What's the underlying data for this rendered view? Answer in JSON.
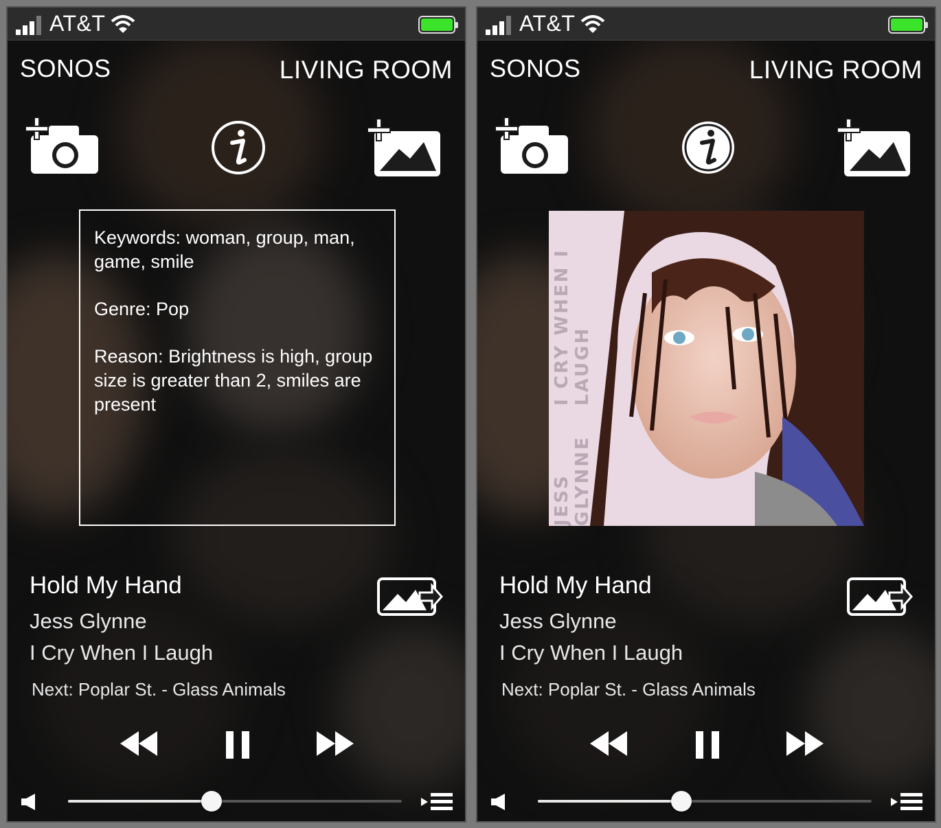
{
  "status_bar": {
    "carrier": "AT&T",
    "signal_bars_filled": 3,
    "signal_bars_total": 4,
    "battery_level": 1.0,
    "battery_color": "#3be32b"
  },
  "header": {
    "brand": "SONOS",
    "room": "LIVING ROOM"
  },
  "icons": {
    "add_camera": "add-camera-icon",
    "info": "info-icon",
    "add_photo": "add-photo-icon",
    "share_image": "share-image-icon",
    "rewind": "rewind-icon",
    "pause": "pause-icon",
    "fast_forward": "fast-forward-icon",
    "volume": "speaker-icon",
    "queue": "queue-icon"
  },
  "screens": [
    {
      "mode": "info",
      "info_panel": {
        "keywords": "Keywords: woman, group, man, game, smile",
        "genre": "Genre: Pop",
        "reason": "Reason: Brightness is high, group size is greater than 2, smiles are present"
      }
    },
    {
      "mode": "album_art",
      "album_art": {
        "spine_text_top": "I CRY WHEN I LAUGH",
        "spine_text_bottom": "JESS GLYNNE"
      }
    }
  ],
  "now_playing": {
    "title": "Hold My Hand",
    "artist": "Jess Glynne",
    "album": "I Cry When I Laugh",
    "next": "Next: Poplar St. - Glass Animals"
  },
  "volume": {
    "level": 0.43
  },
  "colors": {
    "accent": "#ffffff",
    "battery": "#3be32b"
  }
}
